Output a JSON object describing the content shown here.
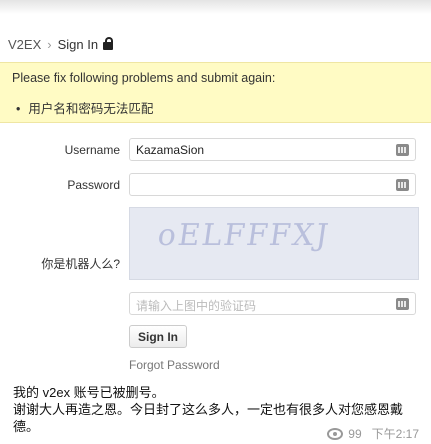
{
  "breadcrumb": {
    "site": "V2EX",
    "separator": "›",
    "page": "Sign In"
  },
  "alert": {
    "title": "Please fix following problems and submit again:",
    "problems": [
      "用户名和密码无法匹配"
    ]
  },
  "form": {
    "username_label": "Username",
    "username_value": "KazamaSion",
    "password_label": "Password",
    "password_value": "",
    "captcha_label": "你是机器人么?",
    "captcha_text": "oELFFFXJ",
    "captcha_placeholder": "请输入上图中的验证码",
    "signin_label": "Sign In",
    "forgot_label": "Forgot Password"
  },
  "caption": "我的 v2ex 账号已被删号。\n谢谢大人再造之恩。今日封了这么多人，一定也有很多人对您感恩戴德。",
  "meta": {
    "views": "99",
    "time": "下午2:17"
  }
}
